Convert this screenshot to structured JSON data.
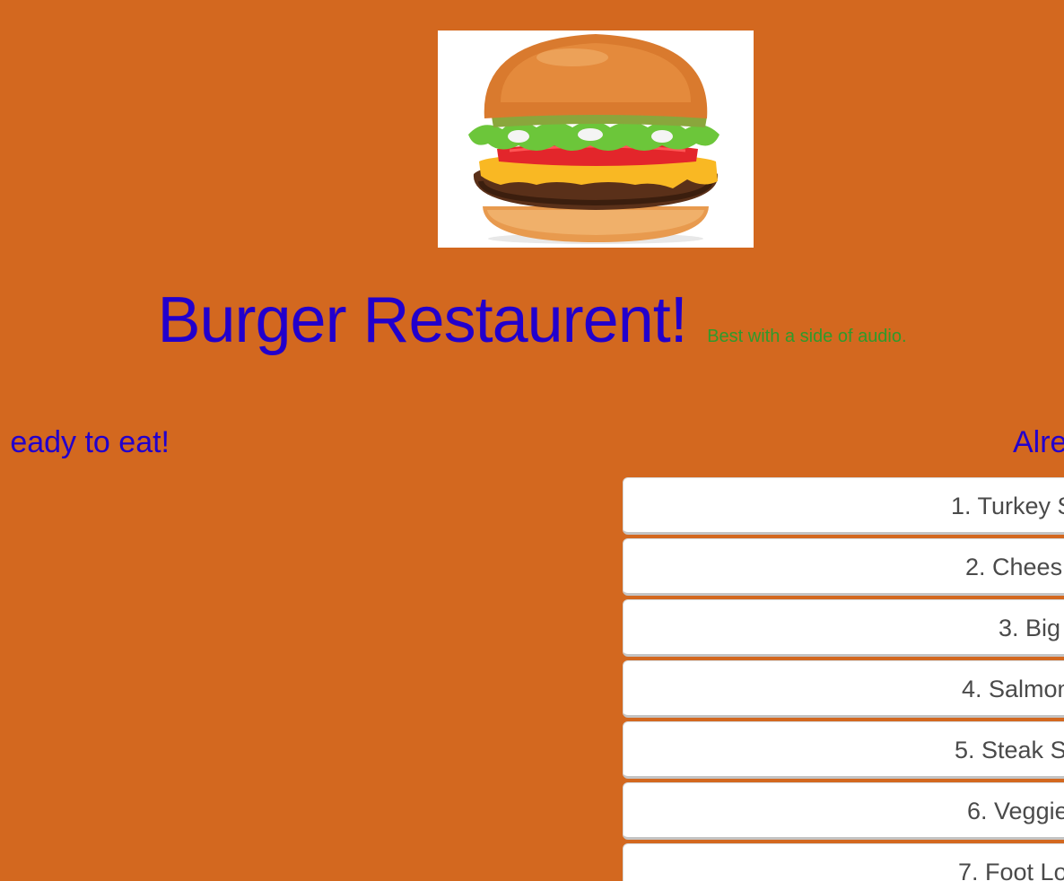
{
  "header": {
    "image_alt": "burger-photo",
    "title": "Burger Restaurent!",
    "tagline": "Best with a side of audio."
  },
  "sections": {
    "ready_heading": "eady to eat!",
    "devoured_heading": "Alre"
  },
  "devoured": [
    {
      "label": "1. Turkey S"
    },
    {
      "label": "2. Chees"
    },
    {
      "label": "3. Big"
    },
    {
      "label": "4. Salmon"
    },
    {
      "label": "5. Steak S"
    },
    {
      "label": "6. Veggie"
    },
    {
      "label": "7. Foot Lo"
    }
  ],
  "colors": {
    "background": "#d3681f",
    "heading": "#2200cc",
    "tagline": "#2f9a2b",
    "item_bg": "#ffffff",
    "item_text": "#4a4a4a"
  }
}
